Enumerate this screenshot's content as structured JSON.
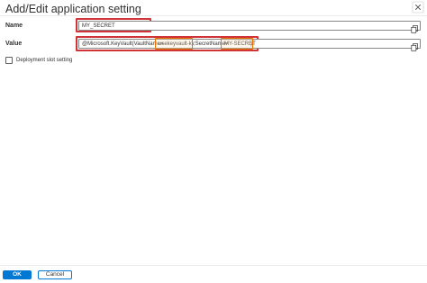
{
  "dialog": {
    "title": "Add/Edit application setting"
  },
  "name_field": {
    "label": "Name",
    "value": "MY_SECRET"
  },
  "value_field": {
    "label": "Value",
    "prefix": "@Microsoft.KeyVault(VaultName=",
    "vault_name": "usekeyvault-kv",
    "middle": ";SecretName=",
    "secret_name": "MY-SECRET",
    "suffix": ")"
  },
  "deployment_slot": {
    "label": "Deployment slot setting",
    "checked": false
  },
  "footer": {
    "ok_label": "OK",
    "cancel_label": "Cancel"
  },
  "colors": {
    "accent": "#0078d4",
    "highlight_red": "#d13438",
    "highlight_orange": "#e87100"
  },
  "icons": [
    "close-icon",
    "copy-icon"
  ]
}
